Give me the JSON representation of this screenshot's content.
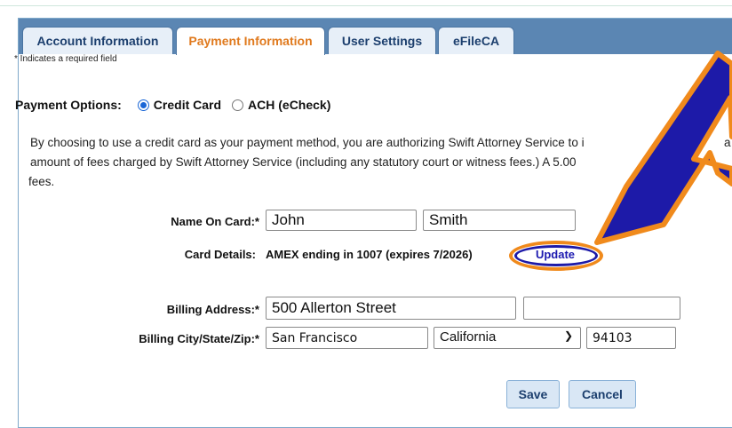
{
  "tabs": [
    {
      "label": "Account Information",
      "active": false
    },
    {
      "label": "Payment Information",
      "active": true
    },
    {
      "label": "User Settings",
      "active": false
    },
    {
      "label": "eFileCA",
      "active": false
    }
  ],
  "required_note": "* Indicates a required field",
  "payment_options": {
    "label": "Payment Options:",
    "credit_card": "Credit Card",
    "ach": "ACH (eCheck)",
    "selected": "Credit Card"
  },
  "disclaimer": {
    "line1": "By choosing to use a credit card as your payment method, you are authorizing Swift Attorney Service to i",
    "line1_tail": "a",
    "line2": "amount of fees charged by Swift Attorney Service (including any statutory court or witness fees.) A 5.00",
    "line3": "fees."
  },
  "form": {
    "name_label": "Name On Card:*",
    "first_name": "John",
    "last_name": "Smith",
    "card_label": "Card Details:",
    "card_text": "AMEX ending in 1007 (expires 7/2026)",
    "update_link": "Update",
    "address_label": "Billing Address:*",
    "address1": "500 Allerton Street",
    "address2": "",
    "city_label": "Billing City/State/Zip:*",
    "city": "San Francisco",
    "state": "California",
    "zip": "94103"
  },
  "buttons": {
    "save": "Save",
    "cancel": "Cancel"
  },
  "colors": {
    "annotation_orange": "#f08a1c",
    "annotation_blue": "#1d1aa8",
    "active_tab_text": "#e07a1e",
    "tab_bar": "#5b86b3"
  },
  "icons": {
    "annotation": "arrow-pointer-icon",
    "dropdown": "chevron-down-icon"
  }
}
